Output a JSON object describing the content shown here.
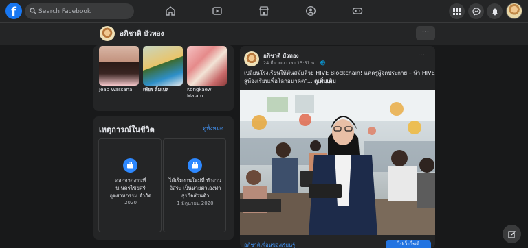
{
  "search": {
    "placeholder": "Search Facebook"
  },
  "profile": {
    "name": "อภิชาติ บัวทอง",
    "more_label": "···"
  },
  "friends": [
    {
      "name": "Jeab Wassana"
    },
    {
      "name": "เพียร ลิ้มเปล"
    },
    {
      "name": "Kongkaew Ma'am"
    }
  ],
  "events": {
    "title": "เหตุการณ์ในชีวิต",
    "see_all": "ดูทั้งหมด",
    "items": [
      {
        "text": "ออกจากงานที่ บ.นครไชยศรี อุตสาหกรรม จำกัด",
        "date": "2020"
      },
      {
        "text": "ได้เริ่มงานใหม่ที่ ทำงานอิสระ เป็นนายตัวเองทำธุรกิจส่วนตัว",
        "date": "1 มิถุนายน 2020"
      }
    ]
  },
  "bottom_snippet": "...",
  "post": {
    "author": "อภิชาติ บัวทอง",
    "time": "24 มีนาคม เวลา 15:51 น. · 🌐",
    "text_main": "เปลี่ยนโรงเรียนให้ทันสมัยด้วย HIVE Blockchain! แค่ครูผู้จุดประกาย – นำ HIVE สู่ห้องเรียนเพื่อโลกอนาคต\"...",
    "see_more": "ดูเพิ่มเติม",
    "more_label": "···",
    "caption_link": "อภิชาติเพื่อนของเรียนรู้",
    "action_label": "ไปเว็บไซต์"
  },
  "colors": {
    "accent": "#2d88ff",
    "link": "#4599ff",
    "surface": "#242526",
    "background": "#18191a"
  }
}
